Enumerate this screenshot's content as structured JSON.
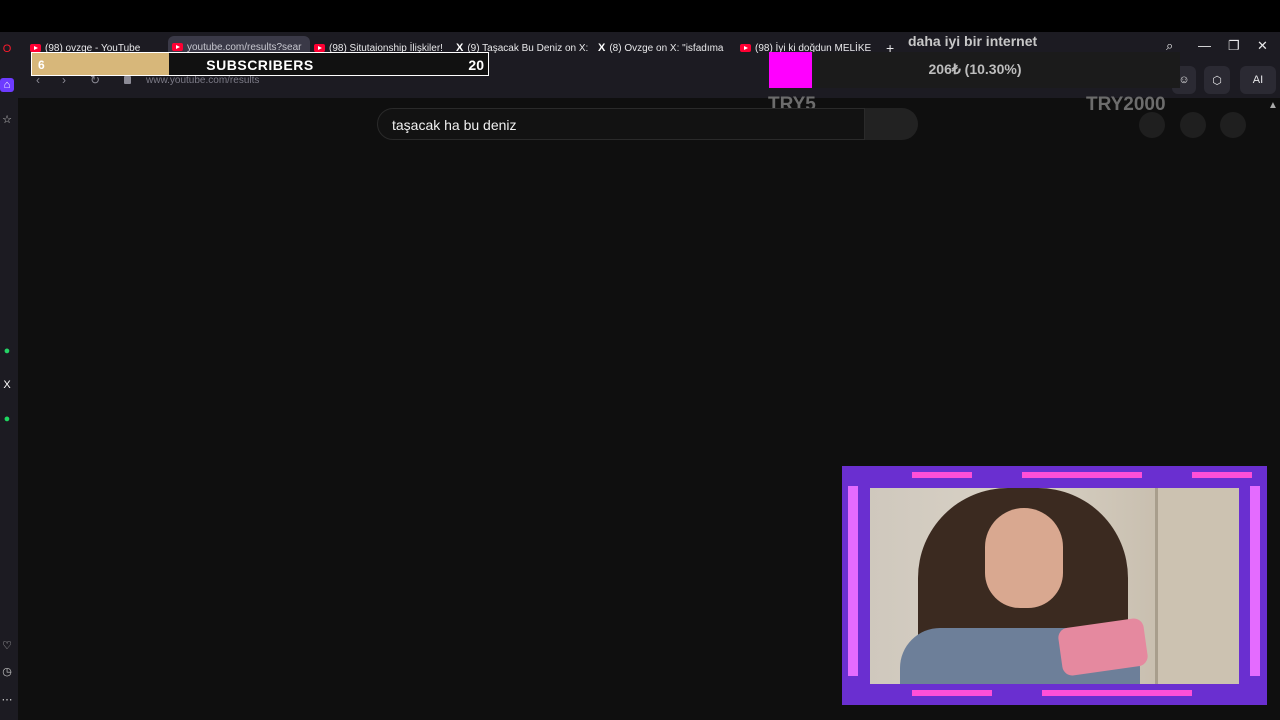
{
  "browser": {
    "tabs": [
      {
        "title": "(98) ovzge - YouTube",
        "favicon": "youtube-icon",
        "active": false
      },
      {
        "title": "youtube.com/results?sear",
        "favicon": "youtube-icon",
        "active": true
      },
      {
        "title": "(98) Situtaionship İlişkiler!",
        "favicon": "youtube-icon",
        "active": false
      },
      {
        "title": "(9) Taşacak Bu Deniz on X:",
        "favicon": "x-icon",
        "active": false
      },
      {
        "title": "(8) Ovzge on X: \"isfadıma",
        "favicon": "x-icon",
        "active": false
      },
      {
        "title": "(98) İyi ki doğdun MELİKE",
        "favicon": "youtube-icon",
        "active": false
      }
    ],
    "new_tab_label": "+",
    "url": "www.youtube.com/results",
    "ai_label": "AI"
  },
  "overlay": {
    "subscribers": {
      "current": "6",
      "label": "SUBSCRIBERS",
      "goal": "20",
      "progress": 0.3
    },
    "goal": {
      "title": "daha iyi bir internet",
      "amount": "206₺ (10.30%)",
      "start": "TRY5",
      "end": "TRY2000",
      "progress": 0.103
    }
  },
  "youtube": {
    "search_query": "taşacak ha bu deniz"
  },
  "colors": {
    "accent": "#ff00ff",
    "sub_fill": "#d7b77a",
    "cam_frame": "#6a2fd0"
  }
}
